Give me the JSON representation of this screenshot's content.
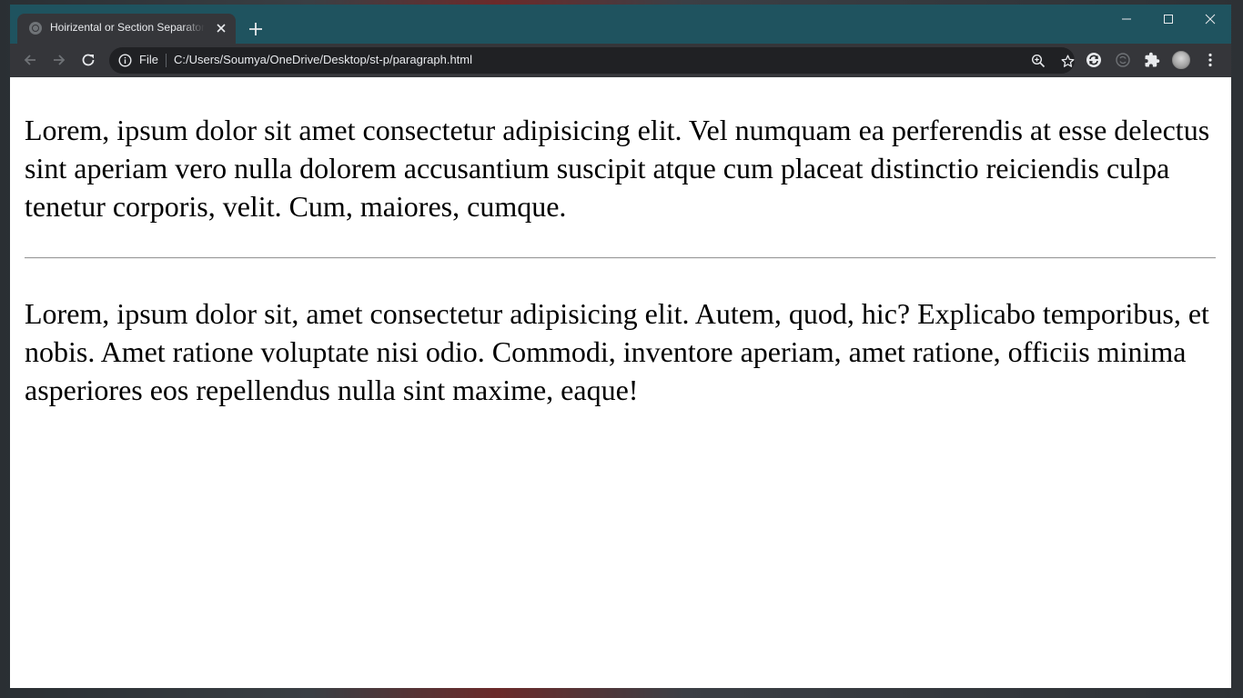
{
  "browser": {
    "tab": {
      "title": "Hoirizental or Section Separator Tag"
    },
    "omnibox": {
      "scheme_label": "File",
      "url": "C:/Users/Soumya/OneDrive/Desktop/st-p/paragraph.html"
    }
  },
  "page": {
    "paragraphs": [
      "Lorem, ipsum dolor sit amet consectetur adipisicing elit. Vel numquam ea perferendis at esse delectus sint aperiam vero nulla dolorem accusantium suscipit atque cum placeat distinctio reiciendis culpa tenetur corporis, velit. Cum, maiores, cumque.",
      "Lorem, ipsum dolor sit, amet consectetur adipisicing elit. Autem, quod, hic? Explicabo temporibus, et nobis. Amet ratione voluptate nisi odio. Commodi, inventore aperiam, amet ratione, officiis minima asperiores eos repellendus nulla sint maxime, eaque!"
    ]
  },
  "icons": {
    "tab_favicon": "globe-icon",
    "tab_close": "close-icon",
    "new_tab": "plus-icon",
    "minimize": "minimize-icon",
    "maximize": "maximize-icon",
    "close_window": "close-icon",
    "back": "arrow-left-icon",
    "forward": "arrow-right-icon",
    "reload": "reload-icon",
    "site_info": "info-icon",
    "zoom": "zoom-icon",
    "bookmark": "star-icon",
    "sync_extension": "sync-icon",
    "extension_disabled": "extension-icon",
    "extensions": "puzzle-icon",
    "profile": "avatar",
    "menu": "kebab-menu-icon"
  },
  "colors": {
    "titlebar": "#1f535f",
    "tab": "#35363a",
    "toolbar": "#35363a",
    "omnibox": "#202124",
    "page_background": "#ffffff",
    "text": "#000000"
  }
}
